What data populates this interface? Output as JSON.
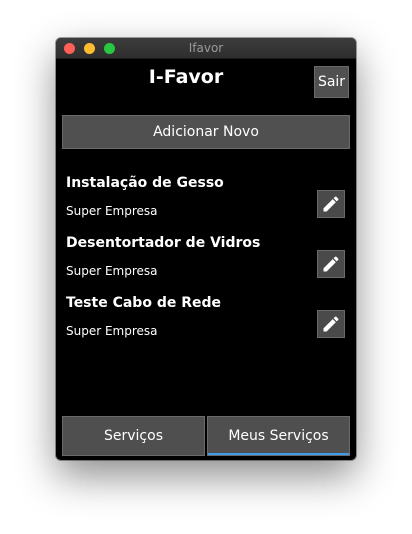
{
  "window": {
    "title": "Ifavor"
  },
  "header": {
    "app_title": "I-Favor",
    "logout_label": "Sair"
  },
  "actions": {
    "add_new_label": "Adicionar Novo"
  },
  "services": [
    {
      "title": "Instalação de Gesso",
      "company": "Super Empresa",
      "edit_icon": "pencil-icon"
    },
    {
      "title": "Desentortador de Vidros",
      "company": "Super Empresa",
      "edit_icon": "pencil-icon"
    },
    {
      "title": "Teste Cabo de Rede",
      "company": "Super Empresa",
      "edit_icon": "pencil-icon"
    }
  ],
  "tabs": [
    {
      "label": "Serviços",
      "active": false
    },
    {
      "label": "Meus Serviços",
      "active": true
    }
  ],
  "colors": {
    "background": "#000000",
    "button": "#505050",
    "active_tab_indicator": "#3d9be9",
    "close": "#fe5f57",
    "minimize": "#febc2e",
    "maximize": "#28c840"
  }
}
